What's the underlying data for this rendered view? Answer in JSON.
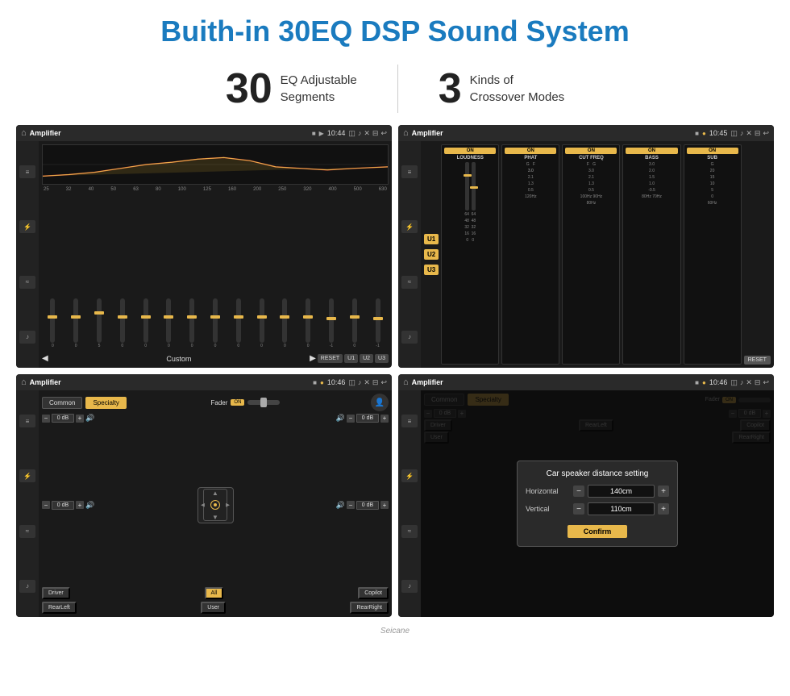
{
  "page": {
    "title": "Buith-in 30EQ DSP Sound System"
  },
  "stats": [
    {
      "number": "30",
      "text_line1": "EQ Adjustable",
      "text_line2": "Segments"
    },
    {
      "number": "3",
      "text_line1": "Kinds of",
      "text_line2": "Crossover Modes"
    }
  ],
  "screens": {
    "screen1": {
      "title": "Amplifier",
      "time": "10:44",
      "eq_labels": [
        "25",
        "32",
        "40",
        "50",
        "63",
        "80",
        "100",
        "125",
        "160",
        "200",
        "250",
        "320",
        "400",
        "500",
        "630"
      ],
      "mode_label": "Custom",
      "reset_label": "RESET",
      "u_labels": [
        "U1",
        "U2",
        "U3"
      ]
    },
    "screen2": {
      "title": "Amplifier",
      "time": "10:45",
      "channels": [
        "LOUDNESS",
        "PHAT",
        "CUT FREQ",
        "BASS",
        "SUB"
      ],
      "u_labels": [
        "U1",
        "U2",
        "U3"
      ],
      "reset_label": "RESET"
    },
    "screen3": {
      "title": "Amplifier",
      "time": "10:46",
      "tab_common": "Common",
      "tab_specialty": "Specialty",
      "fader_label": "Fader",
      "on_label": "ON",
      "db_label": "0 dB",
      "buttons": [
        "Driver",
        "RearLeft",
        "All",
        "User",
        "RearRight",
        "Copilot"
      ]
    },
    "screen4": {
      "title": "Amplifier",
      "time": "10:46",
      "tab_common": "Common",
      "tab_specialty": "Specialty",
      "dialog_title": "Car speaker distance setting",
      "horizontal_label": "Horizontal",
      "horizontal_value": "140cm",
      "vertical_label": "Vertical",
      "vertical_value": "110cm",
      "confirm_label": "Confirm",
      "db_label": "0 dB",
      "buttons": [
        "Driver",
        "RearLeft",
        "User",
        "RearRight",
        "Copilot"
      ]
    }
  },
  "watermark": "Seicane",
  "icons": {
    "home": "⌂",
    "pin": "♦",
    "camera": "◫",
    "volume": "♪",
    "close": "✕",
    "back": "↩",
    "menu": "≡",
    "play": "▶",
    "pause": "❚❚",
    "prev": "◀",
    "next": "▶"
  }
}
